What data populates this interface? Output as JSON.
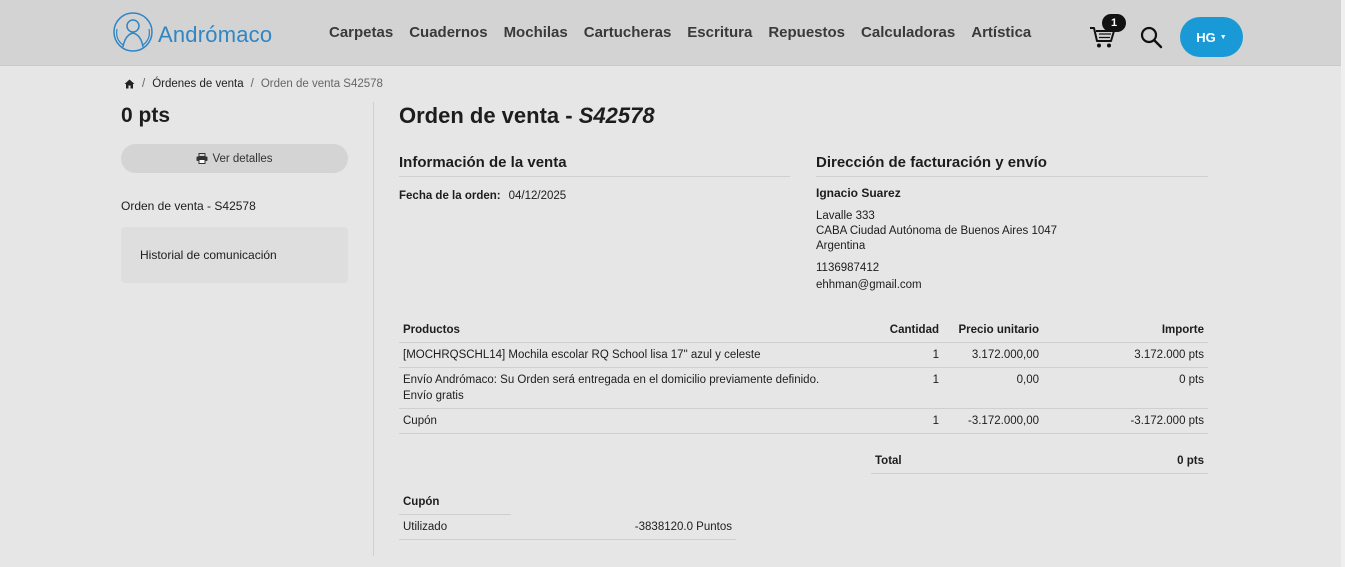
{
  "brand": {
    "name": "Andrómaco"
  },
  "nav": [
    "Carpetas",
    "Cuadernos",
    "Mochilas",
    "Cartucheras",
    "Escritura",
    "Repuestos",
    "Calculadoras",
    "Artística"
  ],
  "cart": {
    "count": "1"
  },
  "user": {
    "initials": "HG"
  },
  "breadcrumb": {
    "level1": "Órdenes de venta",
    "current": "Orden de venta S42578"
  },
  "sidebar": {
    "points": "0 pts",
    "details_button": "Ver detalles",
    "order_label": "Orden de venta - S42578",
    "history_label": "Historial de comunicación"
  },
  "order": {
    "title_prefix": "Orden de venta - ",
    "number": "S42578",
    "info_title": "Información de la venta",
    "date_label": "Fecha de la orden:",
    "date": "04/12/2025",
    "address_title": "Dirección de facturación y envío",
    "customer": "Ignacio Suarez",
    "street": "Lavalle 333",
    "city": "CABA Ciudad Autónoma de Buenos Aires 1047",
    "country": "Argentina",
    "phone": "1136987412",
    "email": "ehhman@gmail.com"
  },
  "table": {
    "headers": {
      "product": "Productos",
      "qty": "Cantidad",
      "unit_price": "Precio unitario",
      "amount": "Importe"
    },
    "rows": [
      {
        "product": "[MOCHRQSCHL14] Mochila escolar RQ School lisa 17\" azul y celeste",
        "qty": "1",
        "unit_price": "3.172.000,00",
        "amount": "3.172.000 pts"
      },
      {
        "product": "Envío Andrómaco: Su Orden será entregada en el domicilio previamente definido.",
        "product2": "Envío gratis",
        "qty": "1",
        "unit_price": "0,00",
        "amount": "0 pts"
      },
      {
        "product": "Cupón",
        "qty": "1",
        "unit_price": "-3.172.000,00",
        "amount": "-3.172.000 pts"
      }
    ],
    "total_label": "Total",
    "total_value": "0 pts"
  },
  "coupon": {
    "title": "Cupón",
    "used_label": "Utilizado",
    "used_value": "-3838120.0 Puntos"
  },
  "colors": {
    "header_bg": "#d3d3d3",
    "page_bg": "#e6e6e6",
    "brand_blue": "#2f86c4",
    "user_button": "#199ad6"
  }
}
